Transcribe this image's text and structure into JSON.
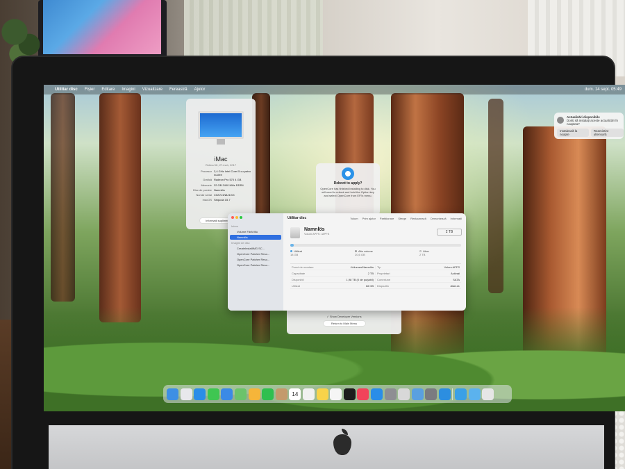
{
  "menubar": {
    "apple": "",
    "app_name": "Utilitar disc",
    "items": [
      "Fișier",
      "Editare",
      "Imagini",
      "Vizualizare",
      "Fereastră",
      "Ajutor"
    ],
    "clock": "dum. 14 sept. 05:49"
  },
  "notification": {
    "title": "Actualizări disponibile",
    "body": "Doriți să instalați aceste actualizări în noaptea?",
    "buttons": [
      "Instalează la noapte",
      "Reamintire ulterioară"
    ]
  },
  "about_mac": {
    "title": "iMac",
    "subtitle": "Retina 5K, 27-inch, 2017",
    "specs": [
      {
        "key": "Procesor",
        "value": "3,4 GHz Intel Core i5 cu patru nuclee"
      },
      {
        "key": "Grafică",
        "value": "Radeon Pro 570 4 GB"
      },
      {
        "key": "Memorie",
        "value": "32 GB 2400 MHz DDR4"
      },
      {
        "key": "Disc de pornire",
        "value": "Namnlös"
      },
      {
        "key": "Număr serial",
        "value": "C02VJ1N8J1GG"
      },
      {
        "key": "macOS",
        "value": "Sequoia 15.7"
      }
    ],
    "more_button": "Informații suplimentare..."
  },
  "reboot_dialog": {
    "title": "Reboot to apply?",
    "text": "OpenCore has finished installing to disk. You will need to reboot and hold the Option key and select OpenCore from EFI's menu."
  },
  "opencore_window": {
    "checkbox_label": "Show Developer Versions",
    "button_label": "Return to Main Menu"
  },
  "disk_utility": {
    "window_title": "Utilitar disc",
    "toolbar": [
      "Volum",
      "Prim ajutor",
      "Partiționare",
      "Șterge",
      "Restaurează",
      "Demontează",
      "Informații"
    ],
    "sidebar_sections": [
      {
        "title": "Intern",
        "items": [
          {
            "label": "Volume Fără titlu",
            "selected": false
          },
          {
            "label": "Namnlös",
            "selected": true
          }
        ]
      },
      {
        "title": "Imagini de disc",
        "items": [
          {
            "label": "CreateInstallIMG SC...",
            "selected": false
          },
          {
            "label": "OpenCore Patcher Reso...",
            "selected": false
          },
          {
            "label": "OpenCore Patcher Reso...",
            "selected": false
          },
          {
            "label": "OpenCore Patcher Reso...",
            "selected": false
          }
        ]
      }
    ],
    "volume": {
      "name": "Namnlös",
      "subtitle": "Volum APFS • APFS",
      "capacity": "2 TB",
      "used_fraction": 0.01
    },
    "legend": [
      {
        "label": "Utilizat",
        "value": "18 GB",
        "color": "#4aa3e4"
      },
      {
        "label": "Alte volume",
        "value": "20,6 GB",
        "color": "#9c9c9c"
      },
      {
        "label": "Liber",
        "value": "2 TB",
        "color": "#e3e3e3"
      }
    ],
    "info_rows": [
      {
        "k1": "Punct de montare",
        "v1": "/Volumes/Namnlös",
        "k2": "Tip",
        "v2": "Volum APFS"
      },
      {
        "k1": "Capacitate",
        "v1": "2 TB",
        "k2": "Proprietari",
        "v2": "Activați"
      },
      {
        "k1": "Disponibil",
        "v1": "1,98 TB (0 de purjabil)",
        "k2": "Conexiune",
        "v2": "SATA"
      },
      {
        "k1": "Utilizat",
        "v1": "18 GB",
        "k2": "Dispozitiv",
        "v2": "disk1s1"
      }
    ]
  },
  "dock": {
    "items": [
      {
        "name": "finder-icon",
        "color": "#3d8fe4"
      },
      {
        "name": "launchpad-icon",
        "color": "#e8e8ec"
      },
      {
        "name": "safari-icon",
        "color": "#2a8de8"
      },
      {
        "name": "messages-icon",
        "color": "#3fc652"
      },
      {
        "name": "mail-icon",
        "color": "#3b8ae6"
      },
      {
        "name": "maps-icon",
        "color": "#6cc36b"
      },
      {
        "name": "photos-icon",
        "color": "#f5b53a"
      },
      {
        "name": "facetime-icon",
        "color": "#2fbf4f"
      },
      {
        "name": "contacts-icon",
        "color": "#c49a6c"
      },
      {
        "name": "calendar-icon",
        "color": "#ffffff"
      },
      {
        "name": "reminders-icon",
        "color": "#f1f1f1"
      },
      {
        "name": "notes-icon",
        "color": "#f8d34a"
      },
      {
        "name": "freeform-icon",
        "color": "#f5f5f5"
      },
      {
        "name": "apple-tv-icon",
        "color": "#1c1c1c"
      },
      {
        "name": "music-icon",
        "color": "#f1435a"
      },
      {
        "name": "app-store-icon",
        "color": "#2a8de8"
      },
      {
        "name": "system-settings-icon",
        "color": "#8e8e93"
      },
      {
        "name": "disk-utility-icon",
        "color": "#d8d8d8"
      },
      {
        "name": "preview-icon",
        "color": "#5aa0e0"
      },
      {
        "name": "screenshot-icon",
        "color": "#7b7b80"
      },
      {
        "name": "opencore-icon",
        "color": "#2c8ee0"
      },
      {
        "name": "utility-icon",
        "color": "#3aa0e6"
      },
      {
        "name": "downloads-icon",
        "color": "#5bb2ee"
      },
      {
        "name": "trash-icon",
        "color": "#e6e6e6"
      }
    ]
  },
  "calendar_day": "14"
}
